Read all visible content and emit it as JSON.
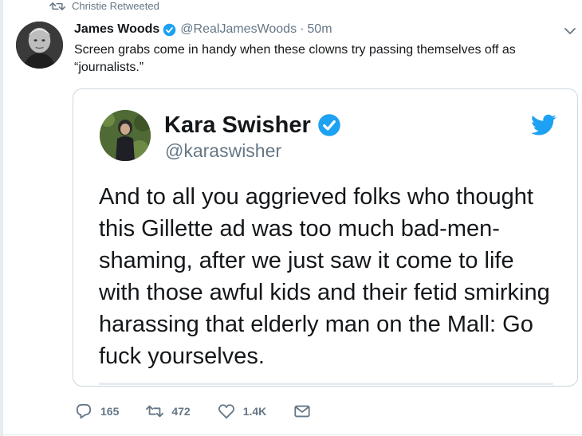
{
  "retweet_context": {
    "text": "Christie Retweeted"
  },
  "tweet": {
    "author_name": "James Woods",
    "author_handle": "@RealJamesWoods",
    "separator": "·",
    "time": "50m",
    "text": "Screen grabs come in handy when these clowns try passing themselves off as “journalists.”"
  },
  "quoted_tweet": {
    "author_name": "Kara Swisher",
    "author_handle": "@karaswisher",
    "text": "And to all you aggrieved folks who thought this Gillette ad was too much bad-men-shaming, after we just saw it come to life with those awful kids and their fetid smirking harassing that elderly man on the Mall: Go fuck yourselves."
  },
  "actions": {
    "reply_count": "165",
    "retweet_count": "472",
    "like_count": "1.4K"
  },
  "icons": {
    "retweet_context": "retweet-icon",
    "verified": "verified-badge-icon",
    "menu": "chevron-down-icon",
    "bird": "twitter-bird-icon",
    "reply": "reply-icon",
    "retweet": "retweet-icon",
    "like": "heart-icon",
    "dm": "envelope-icon"
  },
  "colors": {
    "twitter_blue": "#1da1f2",
    "text_primary": "#14171a",
    "text_secondary": "#657786",
    "border": "#ccd6dd"
  }
}
